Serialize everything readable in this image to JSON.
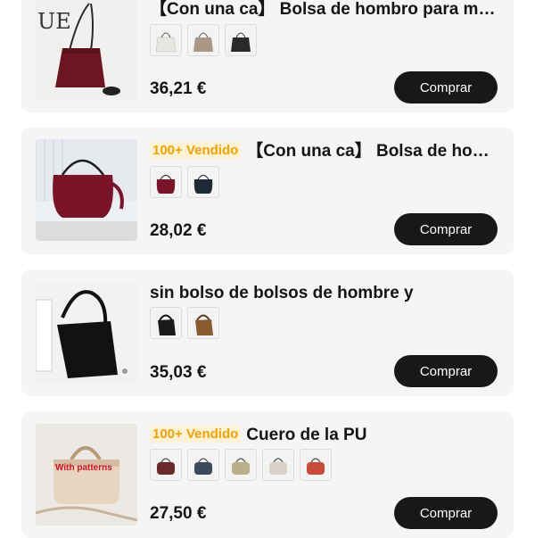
{
  "products": [
    {
      "badge": "",
      "title": "【Con una ca】 Bolsa de hombro para mujer",
      "price": "36,21 €",
      "buy_label": "Comprar",
      "thumb_text": "UE",
      "swatch_colors": [
        "#e8e6e1",
        "#a89885",
        "#2a2a2a"
      ]
    },
    {
      "badge": "100+ Vendido",
      "title": "【Con una ca】 Bolsa de hombro",
      "price": "28,02 €",
      "buy_label": "Comprar",
      "swatch_colors": [
        "#7a1428",
        "#1e2a36"
      ]
    },
    {
      "badge": "",
      "title": "sin bolso de bolsos de hombre y",
      "price": "35,03 €",
      "buy_label": "Comprar",
      "swatch_colors": [
        "#1a1a1a",
        "#8a5a30"
      ]
    },
    {
      "badge": "100+ Vendido",
      "title": "Cuero de la PU",
      "price": "27,50 €",
      "buy_label": "Comprar",
      "thumb_text": "With patterns",
      "swatch_colors": [
        "#6a2a2a",
        "#3a4a5a",
        "#b9b08a",
        "#d9d0c8",
        "#c94c3a"
      ]
    }
  ],
  "colors": {
    "card_bg": "#f5f5f6",
    "badge_text": "#f2a200",
    "button_bg": "#181818"
  }
}
